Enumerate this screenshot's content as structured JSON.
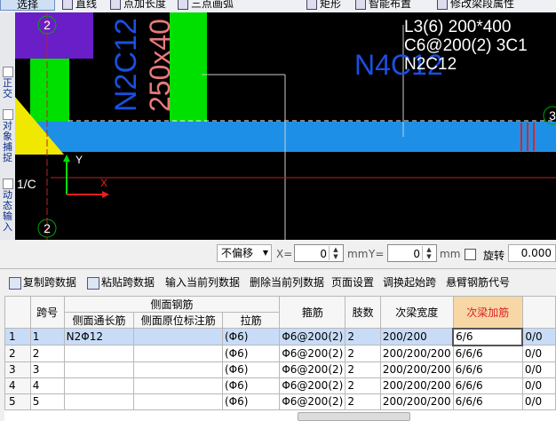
{
  "toolbar": {
    "select_label": "选择",
    "line_label": "直线",
    "point_length_label": "点加长度",
    "arc_label": "三点画弧",
    "rect_label": "矩形",
    "smart_layout_label": "智能布置",
    "modify_beam_label": "修改梁段属性"
  },
  "left_toolbar": {
    "orthogonal_label": "正交",
    "snap_label": "对象捕捉",
    "dynamic_input_label": "动态输入"
  },
  "canvas": {
    "axis_2_top": "2",
    "axis_2_bottom": "2",
    "axis_3": "3",
    "axis_1c": "1/C",
    "y_axis_label": "Y",
    "x_axis_label": "X",
    "text_n2c12_vertical": "N2C12",
    "text_250x40": "250x40",
    "text_n4c12": "N4C12",
    "beam_label_line1": "L3(6) 200*400",
    "beam_label_line2": "C6@200(2) 3C1",
    "beam_label_line3": "N2C12",
    "colors": {
      "beam": "#1e8fe6",
      "green": "#00e000",
      "purple": "#6a1ec8",
      "yellow": "#f0e800",
      "red": "#e82020"
    }
  },
  "status": {
    "offset_value": "不偏移",
    "x_label": "X=",
    "x_value": "0",
    "y_label": "Y=",
    "y_value": "0",
    "unit": "mm",
    "rotate_label": "旋转",
    "rotate_value": "0.000"
  },
  "table_toolbar": {
    "copy_span": "复制跨数据",
    "paste_span": "粘贴跨数据",
    "input_column": "输入当前列数据",
    "delete_column": "删除当前列数据",
    "page_setup": "页面设置",
    "adjust_start": "调换起始跨",
    "cantilever_code": "悬臂钢筋代号"
  },
  "grid": {
    "header_group": "侧面钢筋",
    "headers": {
      "span": "跨号",
      "side_through": "侧面通长筋",
      "side_original": "侧面原位标注筋",
      "tie": "拉筋",
      "stirrup": "箍筋",
      "legs": "肢数",
      "secondary_width": "次梁宽度",
      "secondary_add": "次梁加筋"
    },
    "rows": [
      {
        "rn": "1",
        "span": "1",
        "side_through": "N2Φ12",
        "side_original": "",
        "tie": "(Φ6)",
        "stirrup": "Φ6@200(2)",
        "legs": "2",
        "secondary_width": "200/200",
        "secondary_add": "6/6",
        "extra": "0/0"
      },
      {
        "rn": "2",
        "span": "2",
        "side_through": "",
        "side_original": "",
        "tie": "(Φ6)",
        "stirrup": "Φ6@200(2)",
        "legs": "2",
        "secondary_width": "200/200/200",
        "secondary_add": "6/6/6",
        "extra": "0/0"
      },
      {
        "rn": "3",
        "span": "3",
        "side_through": "",
        "side_original": "",
        "tie": "(Φ6)",
        "stirrup": "Φ6@200(2)",
        "legs": "2",
        "secondary_width": "200/200/200",
        "secondary_add": "6/6/6",
        "extra": "0/0"
      },
      {
        "rn": "4",
        "span": "4",
        "side_through": "",
        "side_original": "",
        "tie": "(Φ6)",
        "stirrup": "Φ6@200(2)",
        "legs": "2",
        "secondary_width": "200/200/200",
        "secondary_add": "6/6/6",
        "extra": "0/0"
      },
      {
        "rn": "5",
        "span": "5",
        "side_through": "",
        "side_original": "",
        "tie": "(Φ6)",
        "stirrup": "Φ6@200(2)",
        "legs": "2",
        "secondary_width": "200/200/200",
        "secondary_add": "6/6/6",
        "extra": "0/0"
      }
    ]
  }
}
